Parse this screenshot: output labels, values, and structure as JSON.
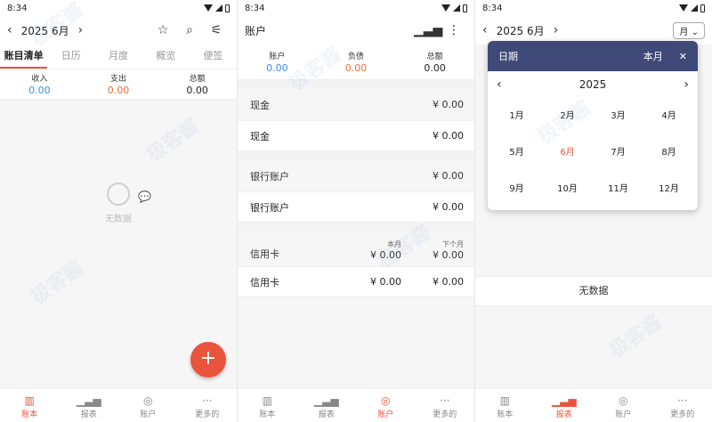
{
  "status": {
    "time": "8:34"
  },
  "p1": {
    "month": "2025 6月",
    "tabs": [
      "账目清单",
      "日历",
      "月度",
      "概览",
      "便签"
    ],
    "summary": [
      {
        "label": "收入",
        "value": "0.00"
      },
      {
        "label": "支出",
        "value": "0.00"
      },
      {
        "label": "总额",
        "value": "0.00"
      }
    ],
    "empty_text": "无数据",
    "fab": "+"
  },
  "p2": {
    "title": "账户",
    "summary": [
      {
        "label": "账户",
        "value": "0.00"
      },
      {
        "label": "负债",
        "value": "0.00"
      },
      {
        "label": "总额",
        "value": "0.00"
      }
    ],
    "cash_header": {
      "label": "现金",
      "amount": "¥ 0.00"
    },
    "cash_row": {
      "label": "现金",
      "amount": "¥ 0.00"
    },
    "bank_header": {
      "label": "银行账户",
      "amount": "¥ 0.00"
    },
    "bank_row": {
      "label": "银行账户",
      "amount": "¥ 0.00"
    },
    "credit_header": {
      "label": "信用卡",
      "col1_label": "本月",
      "col1_amount": "¥ 0.00",
      "col2_label": "下个月",
      "col2_amount": "¥ 0.00"
    },
    "credit_row": {
      "label": "信用卡",
      "col1_amount": "¥ 0.00",
      "col2_amount": "¥ 0.00"
    }
  },
  "p3": {
    "month": "2025 6月",
    "period": "月",
    "picker": {
      "title": "日期",
      "current_month": "本月",
      "year": "2025",
      "months": [
        "1月",
        "2月",
        "3月",
        "4月",
        "5月",
        "6月",
        "7月",
        "8月",
        "9月",
        "10月",
        "11月",
        "12月"
      ],
      "selected": "6月"
    },
    "nodata": "无数据"
  },
  "nav": [
    "账本",
    "报表",
    "账户",
    "更多的"
  ],
  "watermark": "极客酱",
  "colors": {
    "accent": "#e8543c",
    "picker_header": "#3f4a78",
    "blue": "#3a8ee6",
    "orange": "#e8703c"
  }
}
